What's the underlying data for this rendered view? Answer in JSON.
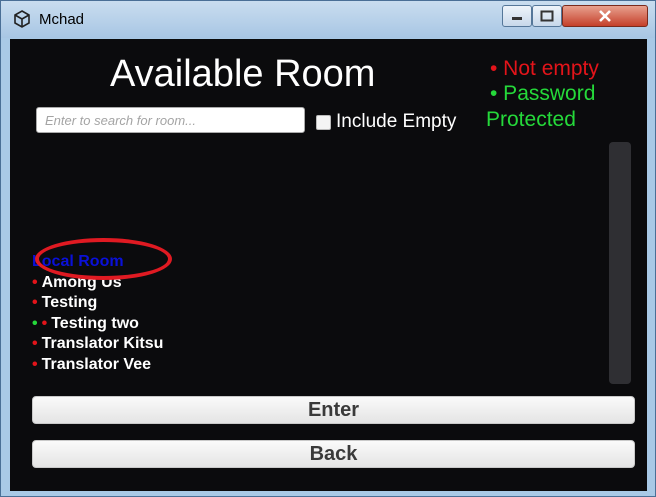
{
  "window": {
    "title": "Mchad",
    "icon": "unity-icon"
  },
  "window_controls": {
    "minimize_icon": "minimize-icon",
    "maximize_icon": "maximize-icon",
    "close_icon": "close-icon"
  },
  "header": {
    "title": "Available Room"
  },
  "legend": {
    "not_empty": "• Not empty",
    "password_line1": "• Password",
    "password_line2": "Protected",
    "colors": {
      "not_empty": "#e3141a",
      "password": "#25d93a"
    }
  },
  "search": {
    "placeholder": "Enter to search for room...",
    "value": ""
  },
  "include_empty": {
    "label": "Include Empty",
    "checked": false
  },
  "rooms": [
    {
      "label": "Local Room",
      "dots": []
    },
    {
      "label": "Among Us",
      "dots": [
        "•"
      ]
    },
    {
      "label": "Testing",
      "dots": [
        "•"
      ]
    },
    {
      "label": "Testing two",
      "dots": [
        "•",
        "•"
      ]
    },
    {
      "label": "Translator Kitsu",
      "dots": [
        "•"
      ]
    },
    {
      "label": "Translator Vee",
      "dots": [
        "•"
      ]
    }
  ],
  "buttons": {
    "enter": "Enter",
    "back": "Back"
  }
}
